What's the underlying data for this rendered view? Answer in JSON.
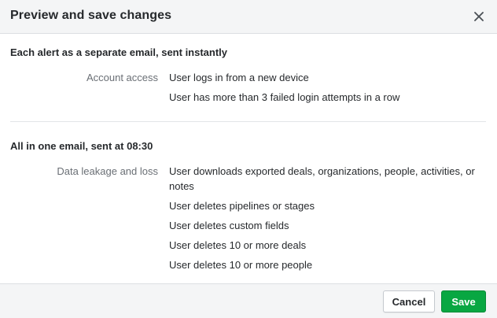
{
  "dialog": {
    "title": "Preview and save changes",
    "close_icon": "close-icon"
  },
  "sections": [
    {
      "title": "Each alert as a separate email, sent instantly",
      "groups": [
        {
          "label": "Account access",
          "items": [
            "User logs in from a new device",
            "User has more than 3 failed login attempts in a row"
          ]
        }
      ]
    },
    {
      "title": "All in one email, sent at 08:30",
      "groups": [
        {
          "label": "Data leakage and loss",
          "items": [
            "User downloads exported deals, organizations, people, activities, or notes",
            "User deletes pipelines or stages",
            "User deletes custom fields",
            "User deletes 10 or more deals",
            "User deletes 10 or more people"
          ]
        }
      ]
    }
  ],
  "footer": {
    "cancel_label": "Cancel",
    "save_label": "Save"
  },
  "colors": {
    "save_button": "#08a742",
    "header_bg": "#f4f5f6"
  }
}
